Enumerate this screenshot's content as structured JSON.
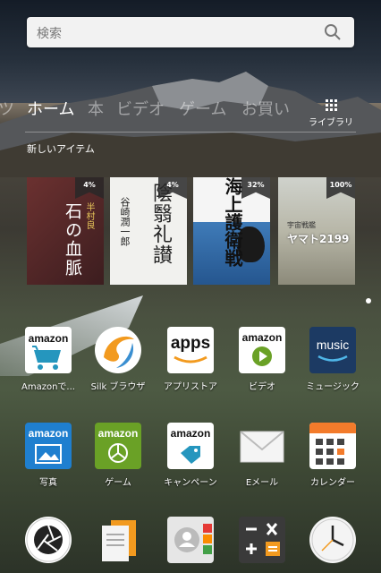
{
  "search": {
    "placeholder": "検索"
  },
  "nav": {
    "tabs": [
      {
        "label": "ツ"
      },
      {
        "label": "ホーム"
      },
      {
        "label": "本"
      },
      {
        "label": "ビデオ"
      },
      {
        "label": "ゲーム"
      },
      {
        "label": "お買い"
      }
    ],
    "library_label": "ライブラリ"
  },
  "section_title": "新しいアイテム",
  "books": [
    {
      "badge": "4%",
      "title": "石の血脈",
      "author": "半村良",
      "color": "#5a2c2c"
    },
    {
      "badge": "4%",
      "title": "陰翳礼讃",
      "author": "谷崎潤一郎",
      "color": "#f1f1ee"
    },
    {
      "badge": "32%",
      "title": "海上護衛戦",
      "author": "",
      "color": "#f5f5f5"
    },
    {
      "badge": "100%",
      "title": "ヤマト2199",
      "author": "宇宙戦艦",
      "color": "#d9d4c4"
    }
  ],
  "apps_row1": [
    {
      "label": "Amazonで...",
      "logo": "amazon"
    },
    {
      "label": "Silk ブラウザ",
      "logo": ""
    },
    {
      "label": "アプリストア",
      "logo": "apps"
    },
    {
      "label": "ビデオ",
      "logo": "amazon"
    },
    {
      "label": "ミュージック",
      "logo": "music"
    }
  ],
  "apps_row2": [
    {
      "label": "写真",
      "logo": "amazon"
    },
    {
      "label": "ゲーム",
      "logo": "amazon"
    },
    {
      "label": "キャンペーン",
      "logo": "amazon"
    },
    {
      "label": "Eメール",
      "logo": ""
    },
    {
      "label": "カレンダー",
      "logo": ""
    }
  ],
  "colors": {
    "music_bg": "#1c3a63",
    "games_green": "#6aa126",
    "amazon_orange": "#f29a1f",
    "calendar_orange": "#f37b2b"
  }
}
